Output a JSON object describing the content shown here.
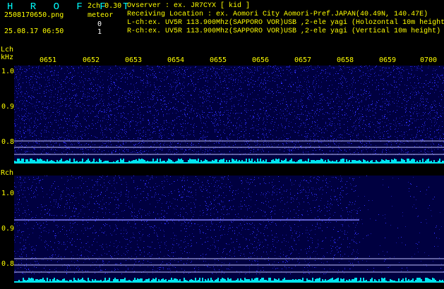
{
  "header": {
    "brand": "H R O F F T",
    "filename": "2508170650.png",
    "datetime": "25.08.17 06:50",
    "mode": "2ch 0.30",
    "meteor_label": "meteor",
    "lch_count": "0",
    "rch_count": "1",
    "observer_line": "Ovserver           : ex. JR7CYX [ kid ]",
    "location_line": "Receiving Location : ex. Aomori City Aomori-Pref.JAPAN(40.49N, 140.47E)",
    "lch_line": "L-ch:ex. UV5R 113.900Mhz(SAPPORO VOR)USB ,2-ele yagi (Holozontal 10m height",
    "rch_line": "R-ch:ex. UV5R 113.900Mhz(SAPPORO VOR)USB ,2-ele yagi (Vertical 10m height)"
  },
  "lch": {
    "label": "Lch",
    "unit": "kHz",
    "yticks": [
      "1.0",
      "0.9",
      "0.8"
    ]
  },
  "rch": {
    "label": "Rch",
    "yticks": [
      "1.0",
      "0.9",
      "0.8"
    ]
  },
  "time_axis": [
    "0651",
    "0652",
    "0653",
    "0654",
    "0655",
    "0656",
    "0657",
    "0658",
    "0659",
    "0700"
  ],
  "colors": {
    "background": "#000000",
    "text": "#ffff00",
    "brand": "#00ffff",
    "noise_dark": "#000040",
    "noise_light": "#3030ff",
    "signal_line": "#8080ff",
    "hline": "#c0c0ff",
    "meter": "#00e5ee"
  }
}
